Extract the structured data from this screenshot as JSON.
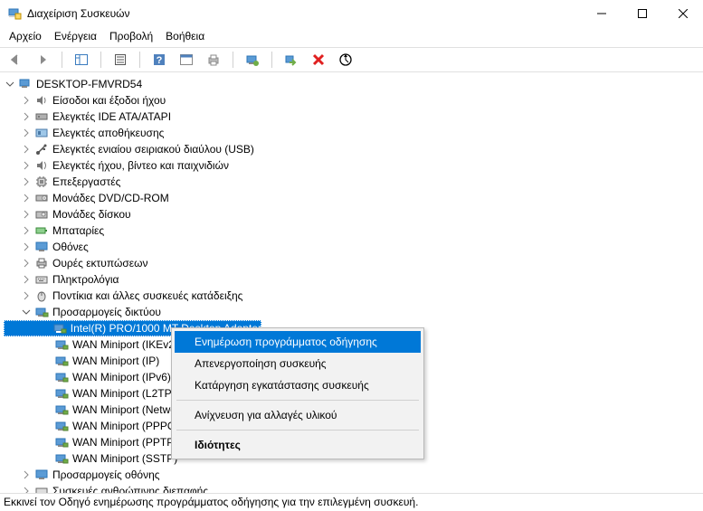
{
  "window": {
    "title": "Διαχείριση Συσκευών"
  },
  "menu": {
    "file": "Αρχείο",
    "action": "Ενέργεια",
    "view": "Προβολή",
    "help": "Βοήθεια"
  },
  "tree": {
    "root": "DESKTOP-FMVRD54",
    "cat_audio_io": "Είσοδοι και έξοδοι ήχου",
    "cat_ide": "Ελεγκτές IDE ATA/ATAPI",
    "cat_storage": "Ελεγκτές αποθήκευσης",
    "cat_usb": "Ελεγκτές ενιαίου σειριακού διαύλου (USB)",
    "cat_sound": "Ελεγκτές ήχου, βίντεο και παιχνιδιών",
    "cat_cpu": "Επεξεργαστές",
    "cat_dvd": "Μονάδες DVD/CD-ROM",
    "cat_disk": "Μονάδες δίσκου",
    "cat_battery": "Μπαταρίες",
    "cat_monitor": "Οθόνες",
    "cat_printq": "Ουρές εκτυπώσεων",
    "cat_keyboard": "Πληκτρολόγια",
    "cat_mouse": "Ποντίκια και άλλες συσκευές κατάδειξης",
    "cat_network": "Προσαρμογείς δικτύου",
    "net_intel": "Intel(R) PRO/1000 MT Desktop Adapter",
    "net_wan_ike": "WAN Miniport (IKEv2)",
    "net_wan_ip": "WAN Miniport (IP)",
    "net_wan_ipv": "WAN Miniport (IPv6)",
    "net_wan_l2t": "WAN Miniport (L2TP)",
    "net_wan_net": "WAN Miniport (Network Monitor)",
    "net_wan_pppoe": "WAN Miniport (PPPOE)",
    "net_wan_pptp": "WAN Miniport (PPTP)",
    "net_wan_sstp": "WAN Miniport (SSTP)",
    "cat_display": "Προσαρμογείς οθόνης",
    "cat_hid": "Συσκευές ανθρώπινης διεπαφής"
  },
  "context": {
    "update": "Ενημέρωση προγράμματος οδήγησης",
    "disable": "Απενεργοποίηση συσκευής",
    "uninstall": "Κατάργηση εγκατάστασης συσκευής",
    "scan": "Ανίχνευση για αλλαγές υλικού",
    "properties": "Ιδιότητες"
  },
  "status": {
    "text": "Εκκινεί τον Οδηγό ενημέρωσης προγράμματος οδήγησης για την επιλεγμένη συσκευή."
  }
}
